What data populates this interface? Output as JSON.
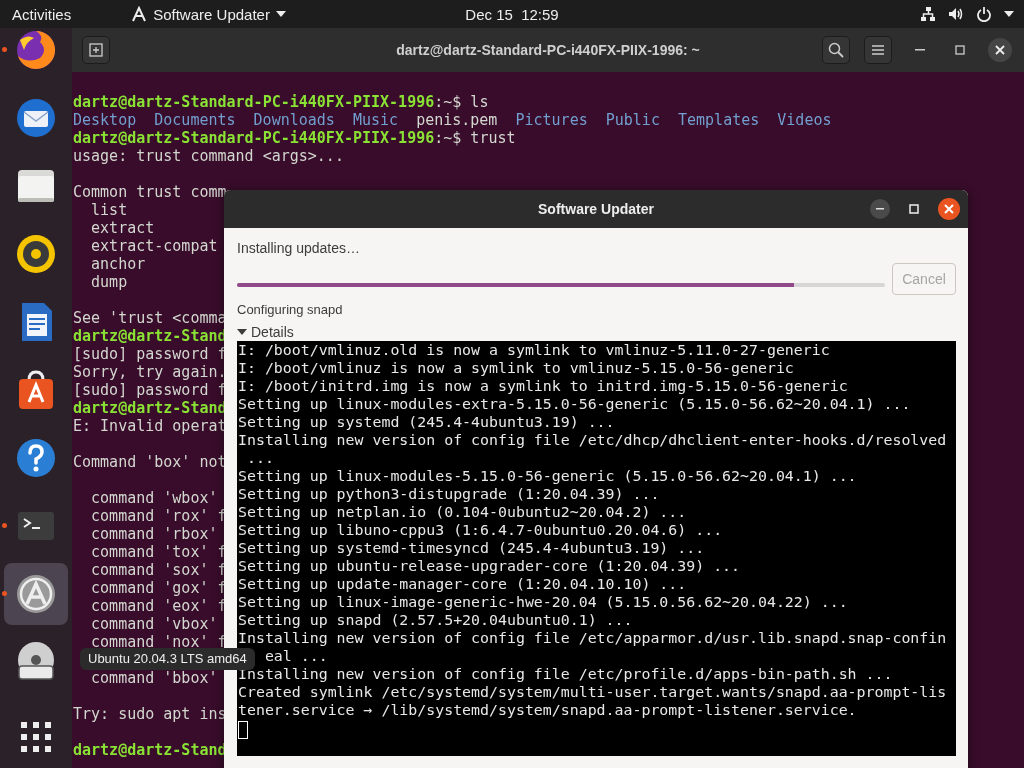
{
  "top_bar": {
    "activities": "Activities",
    "app_menu": "Software Updater",
    "clock": "Dec 15  12:59"
  },
  "dock": {
    "items": [
      {
        "running": true,
        "selected": false
      },
      {
        "running": false,
        "selected": false
      },
      {
        "running": false,
        "selected": false
      },
      {
        "running": false,
        "selected": false
      },
      {
        "running": false,
        "selected": false
      },
      {
        "running": false,
        "selected": false
      },
      {
        "running": false,
        "selected": false
      },
      {
        "running": true,
        "selected": false
      },
      {
        "running": true,
        "selected": true
      },
      {
        "running": false,
        "selected": false
      }
    ],
    "tooltip": "Ubuntu 20.04.3 LTS amd64"
  },
  "terminal": {
    "title": "dartz@dartz-Standard-PC-i440FX-PIIX-1996: ~",
    "lines": [
      {
        "segments": [
          {
            "kind": "prompt",
            "text": "dartz@dartz-Standard-PC-i440FX-PIIX-1996"
          },
          {
            "kind": "plain",
            "text": ":~$ ls"
          }
        ]
      },
      {
        "kind": "listing",
        "segments": [
          {
            "kind": "dir",
            "text": "Desktop"
          },
          {
            "kind": "dir",
            "text": "Documents"
          },
          {
            "kind": "dir",
            "text": "Downloads"
          },
          {
            "kind": "dir",
            "text": "Music"
          },
          {
            "kind": "plain",
            "text": "penis.pem"
          },
          {
            "kind": "dir",
            "text": "Pictures"
          },
          {
            "kind": "dir",
            "text": "Public"
          },
          {
            "kind": "dir",
            "text": "Templates"
          },
          {
            "kind": "dir",
            "text": "Videos"
          }
        ]
      },
      {
        "segments": [
          {
            "kind": "prompt",
            "text": "dartz@dartz-Standard-PC-i440FX-PIIX-1996"
          },
          {
            "kind": "plain",
            "text": ":~$ trust"
          }
        ]
      },
      {
        "segments": [
          {
            "kind": "plain",
            "text": "usage: trust command <args>..."
          }
        ]
      },
      {
        "kind": "blank"
      },
      {
        "segments": [
          {
            "kind": "plain",
            "text": "Common trust comm"
          }
        ]
      },
      {
        "segments": [
          {
            "kind": "plain",
            "text": "  list"
          }
        ]
      },
      {
        "segments": [
          {
            "kind": "plain",
            "text": "  extract"
          }
        ]
      },
      {
        "segments": [
          {
            "kind": "plain",
            "text": "  extract-compat"
          }
        ]
      },
      {
        "segments": [
          {
            "kind": "plain",
            "text": "  anchor"
          }
        ]
      },
      {
        "segments": [
          {
            "kind": "plain",
            "text": "  dump"
          }
        ]
      },
      {
        "kind": "blank"
      },
      {
        "segments": [
          {
            "kind": "plain",
            "text": "See 'trust <comma"
          }
        ]
      },
      {
        "segments": [
          {
            "kind": "prompt",
            "text": "dartz@dartz-Stand"
          }
        ]
      },
      {
        "segments": [
          {
            "kind": "plain",
            "text": "[sudo] password f"
          }
        ]
      },
      {
        "segments": [
          {
            "kind": "plain",
            "text": "Sorry, try again."
          }
        ]
      },
      {
        "segments": [
          {
            "kind": "plain",
            "text": "[sudo] password f"
          }
        ]
      },
      {
        "segments": [
          {
            "kind": "prompt",
            "text": "dartz@dartz-Stand"
          }
        ]
      },
      {
        "segments": [
          {
            "kind": "plain",
            "text": "E: Invalid operat"
          }
        ]
      },
      {
        "kind": "blank"
      },
      {
        "segments": [
          {
            "kind": "plain",
            "text": "Command 'box' not"
          }
        ]
      },
      {
        "kind": "blank"
      },
      {
        "segments": [
          {
            "kind": "plain",
            "text": "  command 'wbox'"
          }
        ]
      },
      {
        "segments": [
          {
            "kind": "plain",
            "text": "  command 'rox' f"
          }
        ]
      },
      {
        "segments": [
          {
            "kind": "plain",
            "text": "  command 'rbox'"
          }
        ]
      },
      {
        "segments": [
          {
            "kind": "plain",
            "text": "  command 'tox' f"
          }
        ]
      },
      {
        "segments": [
          {
            "kind": "plain",
            "text": "  command 'sox' f"
          }
        ]
      },
      {
        "segments": [
          {
            "kind": "plain",
            "text": "  command 'gox' f"
          }
        ]
      },
      {
        "segments": [
          {
            "kind": "plain",
            "text": "  command 'eox' f"
          }
        ]
      },
      {
        "segments": [
          {
            "kind": "plain",
            "text": "  command 'vbox'"
          }
        ]
      },
      {
        "segments": [
          {
            "kind": "plain",
            "text": "  command 'nox' f"
          }
        ]
      },
      {
        "kind": "blank"
      },
      {
        "segments": [
          {
            "kind": "plain",
            "text": "  command 'bbox'"
          }
        ]
      },
      {
        "kind": "blank"
      },
      {
        "segments": [
          {
            "kind": "plain",
            "text": "Try: sudo apt ins"
          }
        ]
      },
      {
        "kind": "blank"
      },
      {
        "segments": [
          {
            "kind": "prompt",
            "text": "dartz@dartz-Stand"
          }
        ]
      }
    ]
  },
  "updater": {
    "title": "Software Updater",
    "status": "Installing updates…",
    "progress": {
      "level": 0.86
    },
    "cancel": {
      "label": "Cancel",
      "disabled": true
    },
    "stage": "Configuring snapd",
    "details": {
      "label": "Details",
      "expanded": true
    },
    "log": [
      {
        "text": "I: /boot/vmlinuz.old is now a symlink to vmlinuz-5.11.0-27-generic"
      },
      {
        "text": "I: /boot/vmlinuz is now a symlink to vmlinuz-5.15.0-56-generic"
      },
      {
        "text": "I: /boot/initrd.img is now a symlink to initrd.img-5.15.0-56-generic"
      },
      {
        "text": "Setting up linux-modules-extra-5.15.0-56-generic (5.15.0-56.62~20.04.1) ..."
      },
      {
        "text": "Setting up systemd (245.4-4ubuntu3.19) ..."
      },
      {
        "text": "Installing new version of config file /etc/dhcp/dhclient-enter-hooks.d/resolved"
      },
      {
        "text": " ..."
      },
      {
        "text": "Setting up linux-modules-5.15.0-56-generic (5.15.0-56.62~20.04.1) ..."
      },
      {
        "text": "Setting up python3-distupgrade (1:20.04.39) ..."
      },
      {
        "text": "Setting up netplan.io (0.104-0ubuntu2~20.04.2) ..."
      },
      {
        "text": "Setting up libuno-cppu3 (1:6.4.7-0ubuntu0.20.04.6) ..."
      },
      {
        "text": "Setting up systemd-timesyncd (245.4-4ubuntu3.19) ..."
      },
      {
        "text": "Setting up ubuntu-release-upgrader-core (1:20.04.39) ..."
      },
      {
        "text": "Setting up update-manager-core (1:20.04.10.10) ..."
      },
      {
        "text": "Setting up linux-image-generic-hwe-20.04 (5.15.0.56.62~20.04.22) ..."
      },
      {
        "text": "Setting up snapd (2.57.5+20.04ubuntu0.1) ..."
      },
      {
        "text": "Installing new version of config file /etc/apparmor.d/usr.lib.snapd.snap-confin"
      },
      {
        "text": "eal ...",
        "kind": "covered"
      },
      {
        "text": "Installing new version of config file /etc/profile.d/apps-bin-path.sh ..."
      },
      {
        "text": "Created symlink /etc/systemd/system/multi-user.target.wants/snapd.aa-prompt-lis"
      },
      {
        "text": "tener.service → /lib/systemd/system/snapd.aa-prompt-listener.service."
      }
    ]
  }
}
